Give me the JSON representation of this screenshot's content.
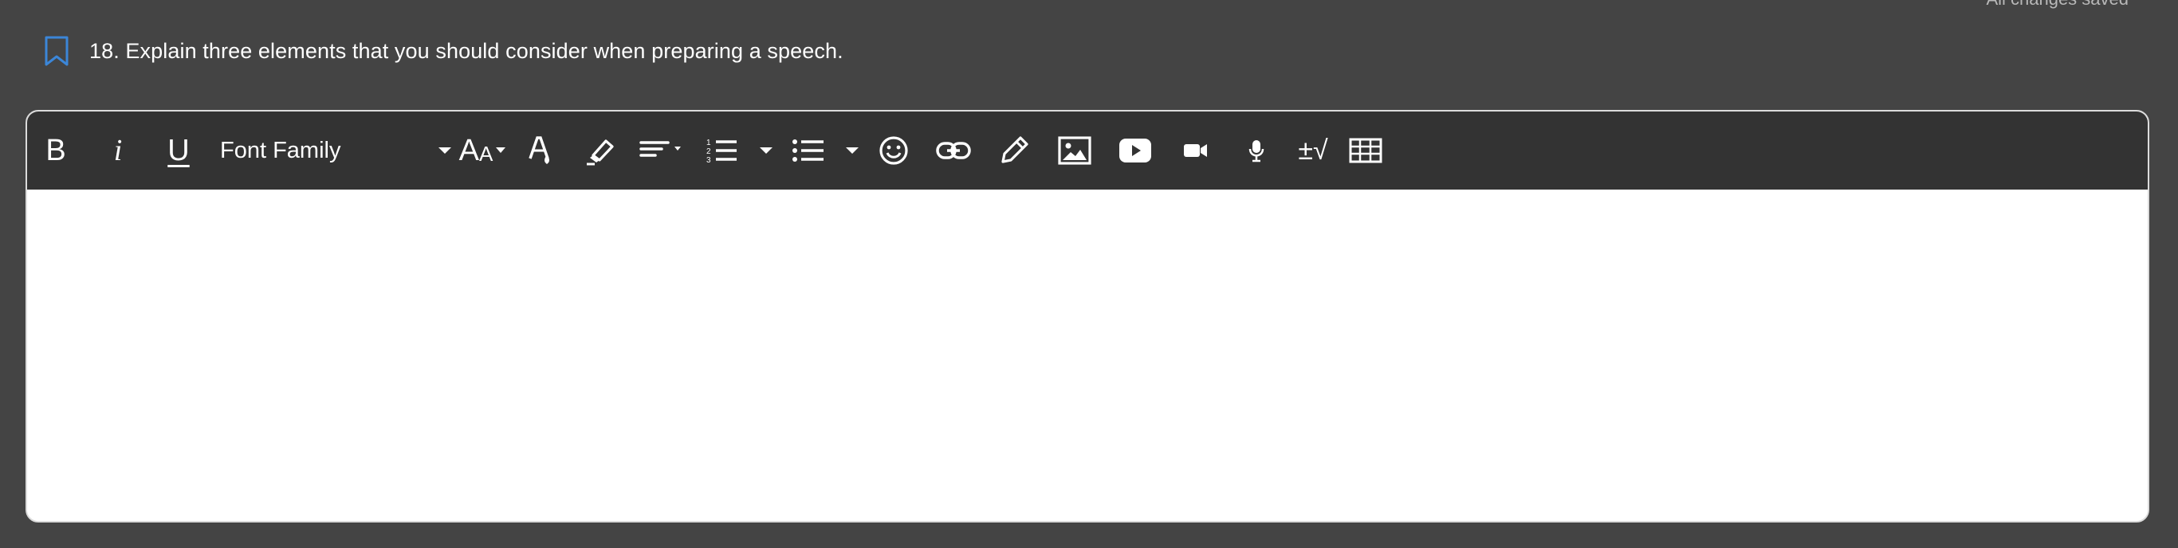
{
  "status": {
    "saved_text": "All changes saved"
  },
  "question": {
    "text": "18. Explain three elements that you should consider when preparing a speech.",
    "bookmark_icon": "bookmark-icon"
  },
  "toolbar": {
    "bold_label": "B",
    "italic_label": "i",
    "underline_label": "U",
    "font_family_label": "Font Family",
    "font_size_label_large": "A",
    "font_size_label_small": "A",
    "math_label": "±√",
    "icons": [
      "bold-icon",
      "italic-icon",
      "underline-icon",
      "font-family-select",
      "font-size-icon",
      "text-color-icon",
      "highlight-icon",
      "align-icon",
      "numbered-list-icon",
      "bullet-list-icon",
      "emoji-icon",
      "link-icon",
      "draw-icon",
      "image-icon",
      "youtube-icon",
      "video-icon",
      "microphone-icon",
      "math-icon",
      "table-icon"
    ]
  },
  "editor": {
    "content": ""
  },
  "colors": {
    "page_bg": "#444444",
    "toolbar_bg": "#333333",
    "bookmark_accent": "#3b86d8",
    "editor_bg": "#ffffff"
  }
}
